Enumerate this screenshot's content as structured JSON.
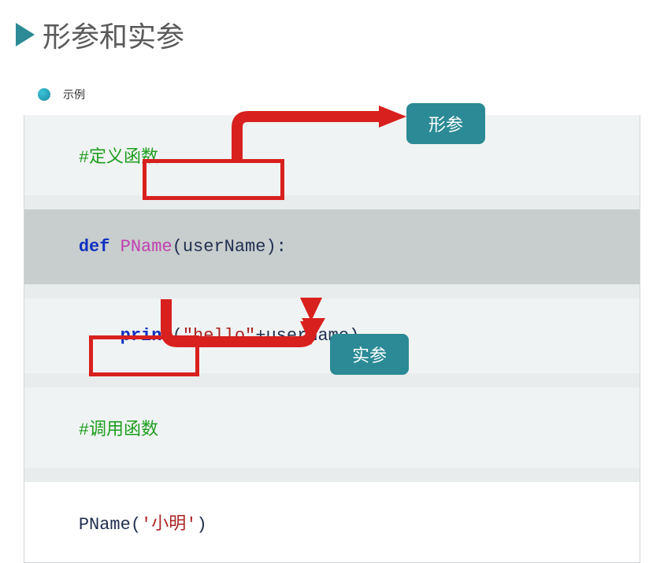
{
  "header": {
    "title": "形参和实参"
  },
  "subheader": {
    "label": "示例"
  },
  "code": {
    "comment_define": "#定义函数",
    "def_kw": "def",
    "func_name": "PName",
    "param_open": "(",
    "param_name": "userName",
    "param_close": ")",
    "colon": ":",
    "print_indent": "    ",
    "print_kw": "print",
    "print_open": "(",
    "print_str": "\"hello\"",
    "plus": "+",
    "print_var": "userName",
    "print_close": ")",
    "comment_call": "#调用函数",
    "call_name": "PName",
    "call_open": "(",
    "call_arg": "'小明'",
    "call_close": ")"
  },
  "callouts": {
    "formal_param": "形参",
    "actual_param": "实参"
  }
}
